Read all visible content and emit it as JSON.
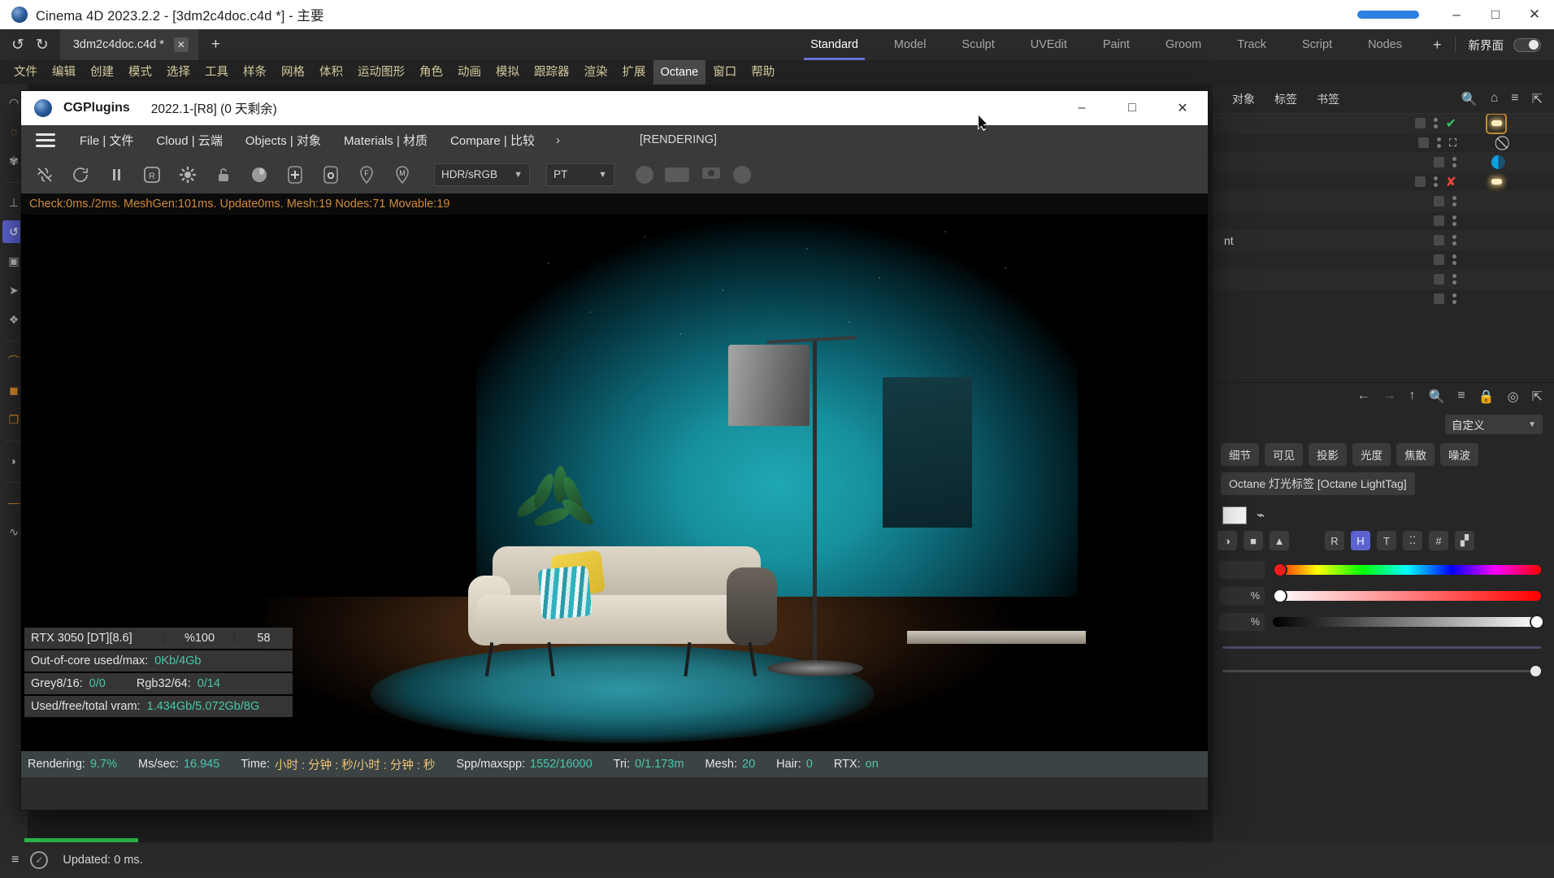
{
  "os_window": {
    "title": "Cinema 4D 2023.2.2 - [3dm2c4doc.c4d *] - 主要",
    "icon": "c4d-logo-icon",
    "minimize": "–",
    "maximize": "□",
    "close": "✕"
  },
  "tabbar": {
    "undo": "↺",
    "redo": "↻",
    "document_tab": "3dm2c4doc.c4d *",
    "tab_close": "✕",
    "new_tab": "+"
  },
  "layouts": {
    "items": [
      "Standard",
      "Model",
      "Sculpt",
      "UVEdit",
      "Paint",
      "Groom",
      "Track",
      "Script",
      "Nodes"
    ],
    "active": "Standard",
    "add": "+",
    "newui_label": "新界面"
  },
  "menubar": {
    "items": [
      "文件",
      "编辑",
      "创建",
      "模式",
      "选择",
      "工具",
      "样条",
      "网格",
      "体积",
      "运动图形",
      "角色",
      "动画",
      "模拟",
      "跟踪器",
      "渲染",
      "扩展",
      "Octane",
      "窗口",
      "帮助"
    ],
    "highlighted": "Octane"
  },
  "left_toolbar": {
    "items": [
      "live-selection-icon",
      "loop-selection-icon",
      "settings-gear-icon",
      "move-axis-icon",
      "rotate-icon",
      "scale-icon",
      "parametric-icon",
      "snap-icon",
      "workplane-icon",
      "spline-pen-icon",
      "cube-primitive-icon",
      "array-objects-icon",
      "deformer-icon",
      "light-icon",
      "camera-icon"
    ],
    "active_index": 4
  },
  "cgplugins": {
    "titlebar": {
      "app_name": "CGPlugins",
      "version": "2022.1-[R8] (0 天剩余)",
      "icon": "octane-logo-icon",
      "minimize": "–",
      "maximize": "□",
      "close": "✕"
    },
    "menu": {
      "hamburger": "menu-icon",
      "items": [
        "File | 文件",
        "Cloud | 云端",
        "Objects | 对象",
        "Materials | 材质",
        "Compare | 比较"
      ],
      "overflow": "›",
      "rendering_label": "[RENDERING]"
    },
    "toolbar": {
      "icons": [
        "stop-render-icon",
        "restart-render-icon",
        "pause-render-icon",
        "region-render-icon",
        "settings-gear-icon",
        "lock-icon",
        "material-sphere-icon",
        "add-node-icon",
        "object-node-icon",
        "focus-pin-icon",
        "material-pin-icon"
      ],
      "colorspace_value": "HDR/sRGB",
      "kernel_value": "PT",
      "right_icons": [
        "sphere-preview-icon",
        "rect-preview-icon",
        "camera-icon",
        "circle-icon"
      ]
    },
    "statline": "Check:0ms./2ms. MeshGen:101ms. Update0ms. Mesh:19 Nodes:71 Movable:19",
    "gpu_overlay": {
      "device": "RTX 3050 [DT][8.6]",
      "usage": "%100",
      "temp": "58",
      "ooc_label": "Out-of-core used/max:",
      "ooc_value": "0Kb/4Gb",
      "grey_label": "Grey8/16: ",
      "grey_value": "0/0",
      "rgb_label": "Rgb32/64: ",
      "rgb_value": "0/14",
      "vram_label": "Used/free/total vram: ",
      "vram_value": "1.434Gb/5.072Gb/8G"
    },
    "render_status": {
      "rendering_label": "Rendering:",
      "rendering_value": "9.7%",
      "mssec_label": "Ms/sec:",
      "mssec_value": "16.945",
      "time_label": "Time:",
      "time_value": "小时 : 分钟 : 秒/小时 : 分钟 : 秒",
      "spp_label": "Spp/maxspp:",
      "spp_value": "1552/16000",
      "tri_label": "Tri:",
      "tri_value": "0/1.173m",
      "mesh_label": "Mesh:",
      "mesh_value": "20",
      "hair_label": "Hair:",
      "hair_value": "0",
      "rtx_label": "RTX:",
      "rtx_value": "on"
    }
  },
  "right_panel": {
    "object_manager": {
      "tabs": [
        "对象",
        "标签",
        "书签"
      ],
      "icons": [
        "search-icon",
        "home-icon",
        "filter-icon",
        "open-external-icon"
      ],
      "rows": [
        {
          "name": "",
          "state": "check",
          "tag": "light",
          "selected": true
        },
        {
          "name": "",
          "state": "expand",
          "tag": "disabled"
        },
        {
          "name": "",
          "state": "",
          "tag": "halfcircle"
        },
        {
          "name": "",
          "state": "cross",
          "tag": "light"
        },
        {
          "name": "",
          "state": "",
          "tag": ""
        },
        {
          "name": "",
          "state": "",
          "tag": ""
        },
        {
          "name": "nt",
          "state": "",
          "tag": ""
        },
        {
          "name": "",
          "state": "",
          "tag": ""
        },
        {
          "name": "",
          "state": "",
          "tag": ""
        },
        {
          "name": "",
          "state": "",
          "tag": ""
        }
      ]
    },
    "attribute_manager": {
      "icons": [
        "back-arrow-icon",
        "forward-arrow-icon",
        "up-arrow-icon",
        "search-icon",
        "filter-icon",
        "lock-icon",
        "target-icon",
        "open-external-icon"
      ],
      "preset_value": "自定义",
      "tabs": [
        "细节",
        "可见",
        "投影",
        "光度",
        "焦散",
        "噪波"
      ],
      "title": "Octane 灯光标签 [Octane LightTag]",
      "color": {
        "swatch_hex": "#f2f2f2",
        "eyedropper": "eyedropper-icon",
        "mode_buttons": [
          "R",
          "H",
          "T",
          "⁚⁚",
          "#",
          "▞"
        ],
        "active_mode": "H",
        "sliders": [
          {
            "label": "",
            "type": "hue",
            "pos": 2
          },
          {
            "label": "%",
            "type": "saturation",
            "pos": 2
          },
          {
            "label": "%",
            "type": "value",
            "pos": 100
          }
        ]
      }
    }
  },
  "main_status": {
    "hamburger": "menu-icon",
    "check_icon": "check-circle-icon",
    "text": "Updated: 0 ms."
  },
  "colors": {
    "accent_blue": "#6a6fd8",
    "green_value": "#49c7a8",
    "orange_stat": "#d08a3a",
    "menu_gold": "#d6cda0",
    "progress_green": "#2bbf4d"
  }
}
